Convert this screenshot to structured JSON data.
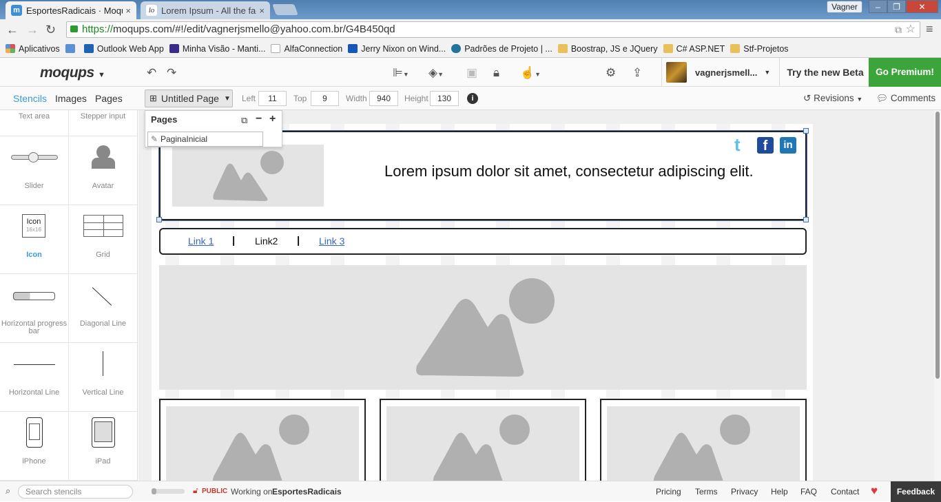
{
  "browser": {
    "tabs": [
      {
        "title": "EsportesRadicais · Moqups",
        "favicon": "moqups-icon",
        "close": "×"
      },
      {
        "title": "Lorem Ipsum - All the facts",
        "favicon": "lorem-icon",
        "close": "×"
      }
    ],
    "window_user": "Vagner",
    "url_https": "https://",
    "url_rest": "moqups.com/#!/edit/vagnerjsmello@yahoo.com.br/G4B450qd"
  },
  "bookmarks": [
    {
      "label": "Aplicativos",
      "color": "#d9534f"
    },
    {
      "label": "",
      "color": "#5b8fd6"
    },
    {
      "label": "Outlook Web App",
      "color": "#1f63b5"
    },
    {
      "label": "Minha Visão - Manti...",
      "color": "#3a2a8a"
    },
    {
      "label": "AlfaConnection",
      "color": "#eeeeee"
    },
    {
      "label": "Jerry Nixon on Wind...",
      "color": "#1656b7"
    },
    {
      "label": "Padrões de Projeto | ...",
      "color": "#21759b"
    },
    {
      "label": "Boostrap, JS e JQuery",
      "color": "#e8c15a"
    },
    {
      "label": "C# ASP.NET",
      "color": "#e8c15a"
    },
    {
      "label": "Stf-Projetos",
      "color": "#e8c15a"
    }
  ],
  "app": {
    "logo": "moqups",
    "username": "vagnerjsmell...",
    "try_beta": "Try the new Beta",
    "premium": "Go Premium!"
  },
  "toolbar2": {
    "tabs": [
      "Stencils",
      "Images",
      "Pages"
    ],
    "page_name": "Untitled Page",
    "left_label": "Left",
    "left_value": "11",
    "top_label": "Top",
    "top_value": "9",
    "width_label": "Width",
    "width_value": "940",
    "height_label": "Height",
    "height_value": "130",
    "info": "i",
    "revisions": "Revisions",
    "comments": "Comments"
  },
  "pages_dropdown": {
    "title": "Pages",
    "page_item": "PaginaInicial"
  },
  "stencils": [
    {
      "label": "Text area"
    },
    {
      "label": "Stepper input"
    },
    {
      "label": "Slider"
    },
    {
      "label": "Avatar"
    },
    {
      "label": "Icon",
      "icon_text": "Icon",
      "icon_sub": "16x16"
    },
    {
      "label": "Grid"
    },
    {
      "label": "Horizontal progress bar"
    },
    {
      "label": "Diagonal Line"
    },
    {
      "label": "Horizontal Line"
    },
    {
      "label": "Vertical Line"
    },
    {
      "label": "iPhone"
    },
    {
      "label": "iPad"
    }
  ],
  "canvas": {
    "headline": "Lorem ipsum dolor sit amet, consectetur adipiscing elit.",
    "links": [
      "Link 1",
      "Link2",
      "Link 3"
    ],
    "separator": "|"
  },
  "status": {
    "search_placeholder": "Search stencils",
    "public": "PUBLIC",
    "working_on": "Working on",
    "project": "EsportesRadicais",
    "footer_links": [
      "Pricing",
      "Terms",
      "Privacy",
      "Help",
      "FAQ",
      "Contact"
    ],
    "feedback": "Feedback"
  },
  "colors": {
    "accent": "#3a9ad9",
    "premium": "#3ba53b",
    "link": "#3366cc"
  }
}
